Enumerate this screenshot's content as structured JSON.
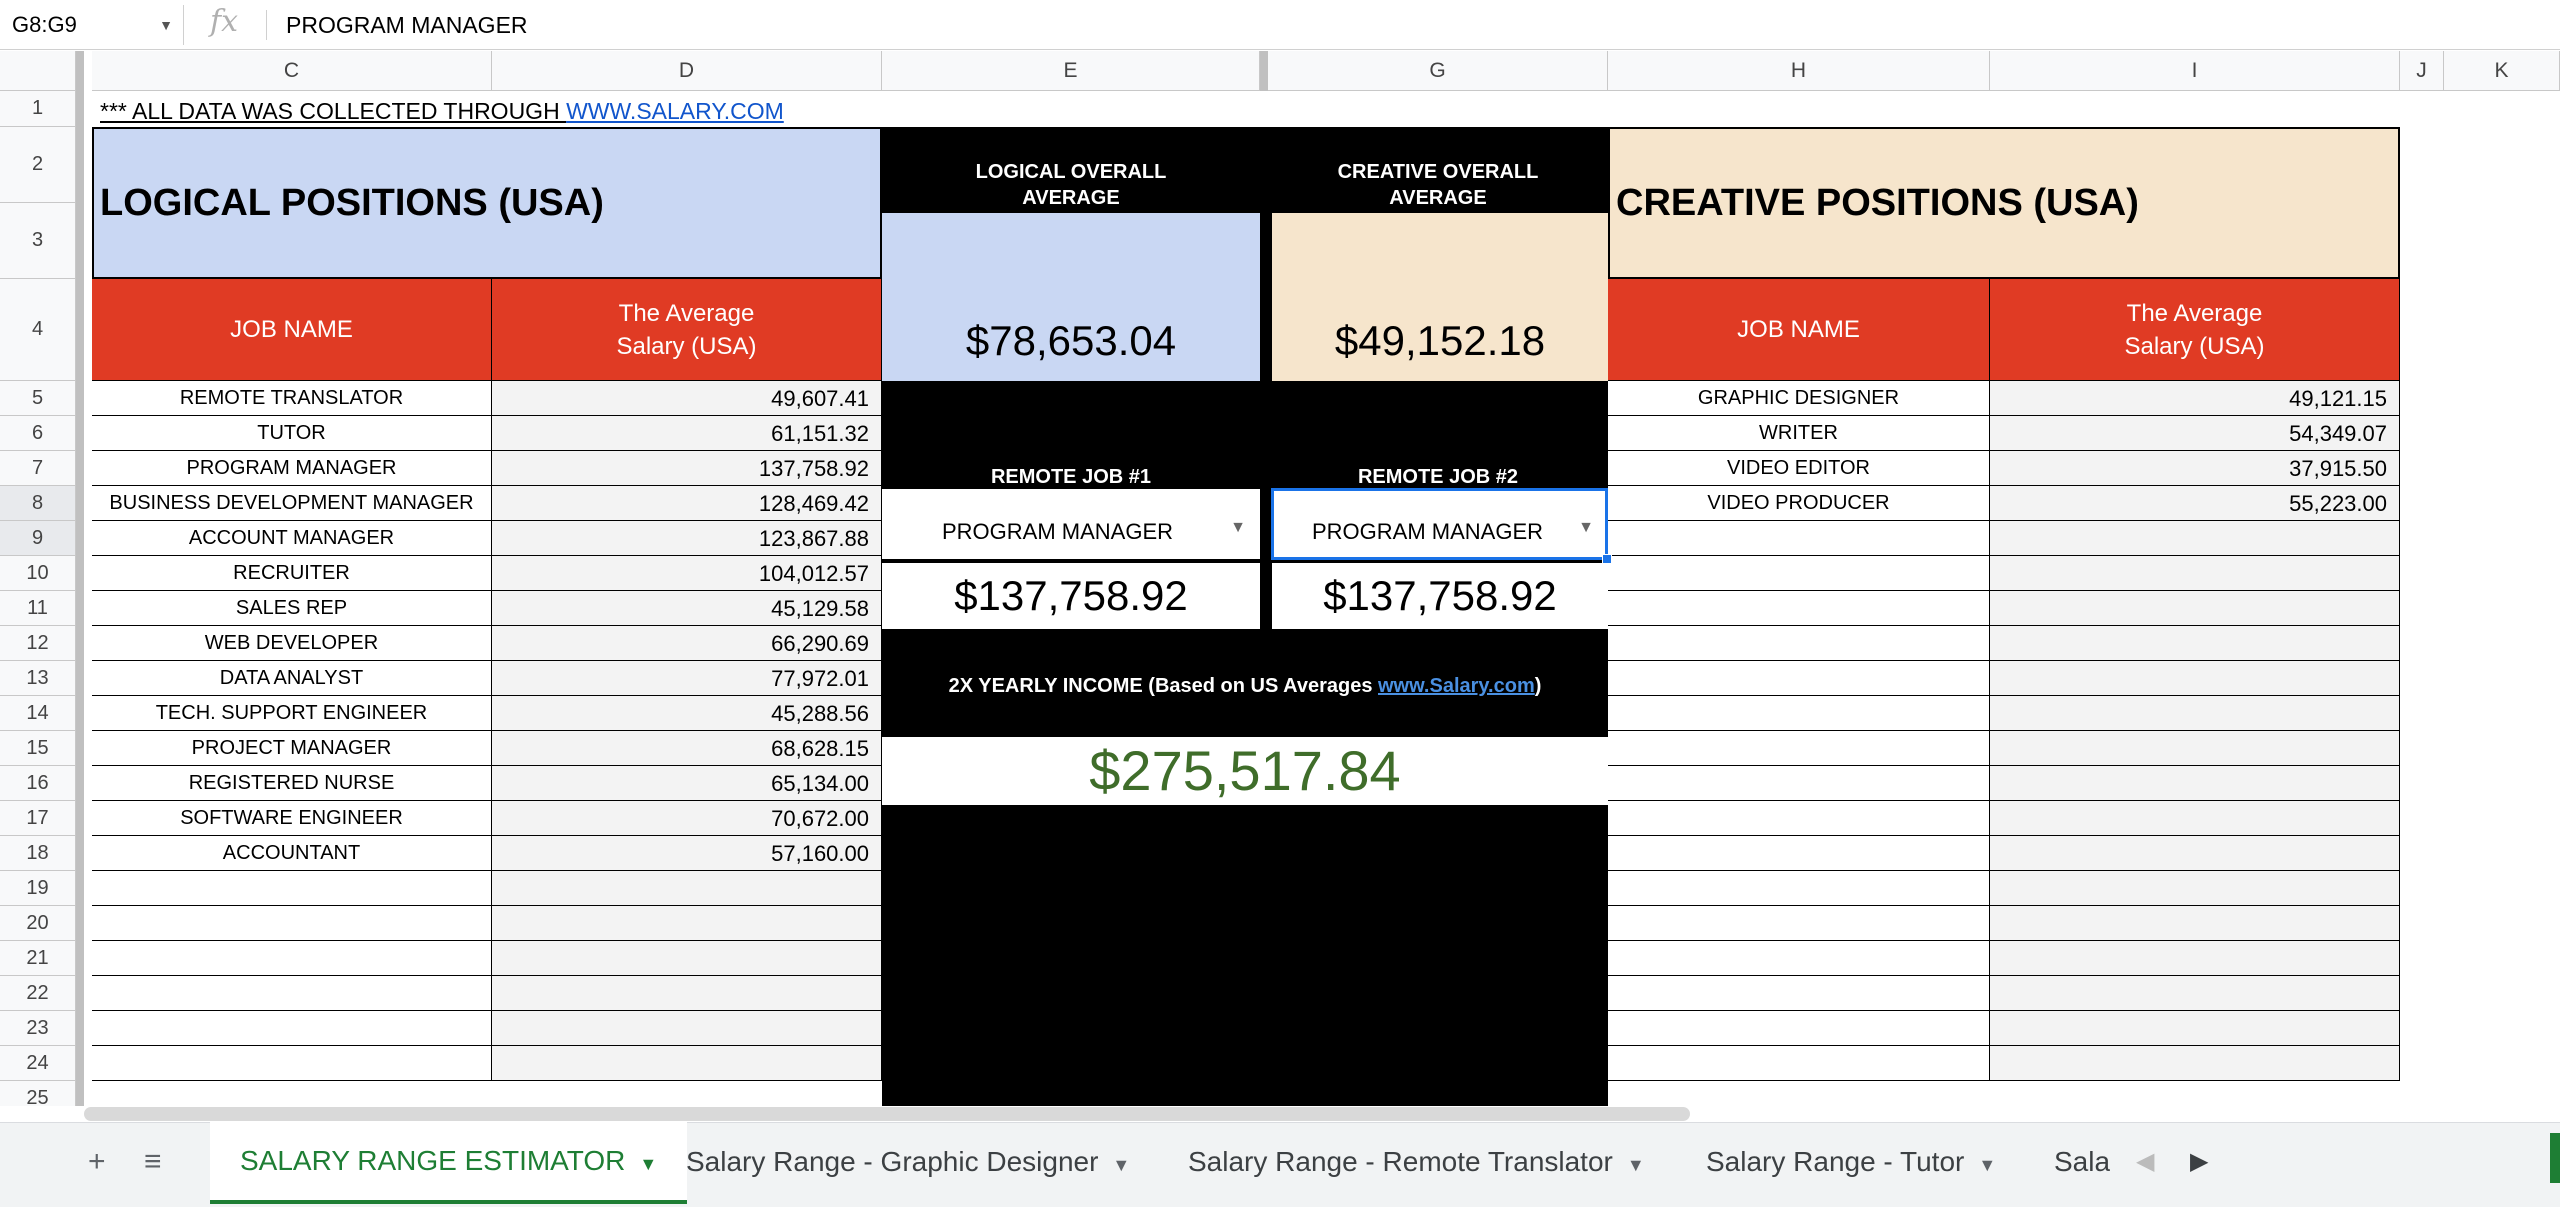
{
  "formula_bar": {
    "name_box": "G8:G9",
    "fx": "fx",
    "value": "PROGRAM MANAGER"
  },
  "columns": [
    "C",
    "D",
    "E",
    "G",
    "H",
    "I",
    "J",
    "K"
  ],
  "rows": [
    "1",
    "2",
    "3",
    "4",
    "5",
    "6",
    "7",
    "8",
    "9",
    "10",
    "11",
    "12",
    "13",
    "14",
    "15",
    "16",
    "17",
    "18",
    "19",
    "20",
    "21",
    "22",
    "23",
    "24",
    "25"
  ],
  "note": {
    "prefix": "*** ALL DATA WAS COLLECTED THROUGH ",
    "link": "WWW.SALARY.COM"
  },
  "logical": {
    "title": "LOGICAL POSITIONS (USA)",
    "col_job": "JOB NAME",
    "col_salary_1": "The Average",
    "col_salary_2": "Salary (USA)",
    "jobs": [
      {
        "name": "REMOTE TRANSLATOR",
        "salary": "49,607.41"
      },
      {
        "name": "TUTOR",
        "salary": "61,151.32"
      },
      {
        "name": "PROGRAM MANAGER",
        "salary": "137,758.92"
      },
      {
        "name": "BUSINESS DEVELOPMENT MANAGER",
        "salary": "128,469.42"
      },
      {
        "name": "ACCOUNT MANAGER",
        "salary": "123,867.88"
      },
      {
        "name": "RECRUITER",
        "salary": "104,012.57"
      },
      {
        "name": "SALES REP",
        "salary": "45,129.58"
      },
      {
        "name": "WEB DEVELOPER",
        "salary": "66,290.69"
      },
      {
        "name": "DATA ANALYST",
        "salary": "77,972.01"
      },
      {
        "name": "TECH. SUPPORT ENGINEER",
        "salary": "45,288.56"
      },
      {
        "name": "PROJECT MANAGER",
        "salary": "68,628.15"
      },
      {
        "name": "REGISTERED NURSE",
        "salary": "65,134.00"
      },
      {
        "name": "SOFTWARE ENGINEER",
        "salary": "70,672.00"
      },
      {
        "name": "ACCOUNTANT",
        "salary": "57,160.00"
      }
    ]
  },
  "creative": {
    "title": "CREATIVE POSITIONS (USA)",
    "col_job": "JOB NAME",
    "col_salary_1": "The Average",
    "col_salary_2": "Salary (USA)",
    "jobs": [
      {
        "name": "GRAPHIC DESIGNER",
        "salary": "49,121.15"
      },
      {
        "name": "WRITER",
        "salary": "54,349.07"
      },
      {
        "name": "VIDEO EDITOR",
        "salary": "37,915.50"
      },
      {
        "name": "VIDEO PRODUCER",
        "salary": "55,223.00"
      }
    ]
  },
  "middle": {
    "logical_avg_label_1": "LOGICAL OVERALL",
    "logical_avg_label_2": "AVERAGE",
    "logical_avg": "$78,653.04",
    "creative_avg_label_1": "CREATIVE OVERALL",
    "creative_avg_label_2": "AVERAGE",
    "creative_avg": "$49,152.18",
    "job1_label": "REMOTE JOB #1",
    "job1_value": "PROGRAM MANAGER",
    "job1_salary": "$137,758.92",
    "job2_label": "REMOTE JOB #2",
    "job2_value": "PROGRAM MANAGER",
    "job2_salary": "$137,758.92",
    "yearly_label": "2X YEARLY INCOME (Based on US Averages ",
    "yearly_link": "www.Salary.com",
    "yearly_close": ")",
    "total": "$275,517.84"
  },
  "colors": {
    "logical_bg": "#c9d7f3",
    "creative_bg": "#f6e5cc",
    "header_red": "#e03b24",
    "total_green": "#3f6d2a"
  },
  "tabs": [
    {
      "label": "SALARY RANGE ESTIMATOR",
      "active": true
    },
    {
      "label": "Salary Range - Graphic Designer"
    },
    {
      "label": "Salary Range - Remote Translator"
    },
    {
      "label": "Salary Range - Tutor"
    },
    {
      "label": "Sala"
    }
  ],
  "tab_icons": [
    "add-sheet-icon",
    "all-sheets-icon",
    "scroll-left-icon",
    "scroll-right-icon"
  ]
}
